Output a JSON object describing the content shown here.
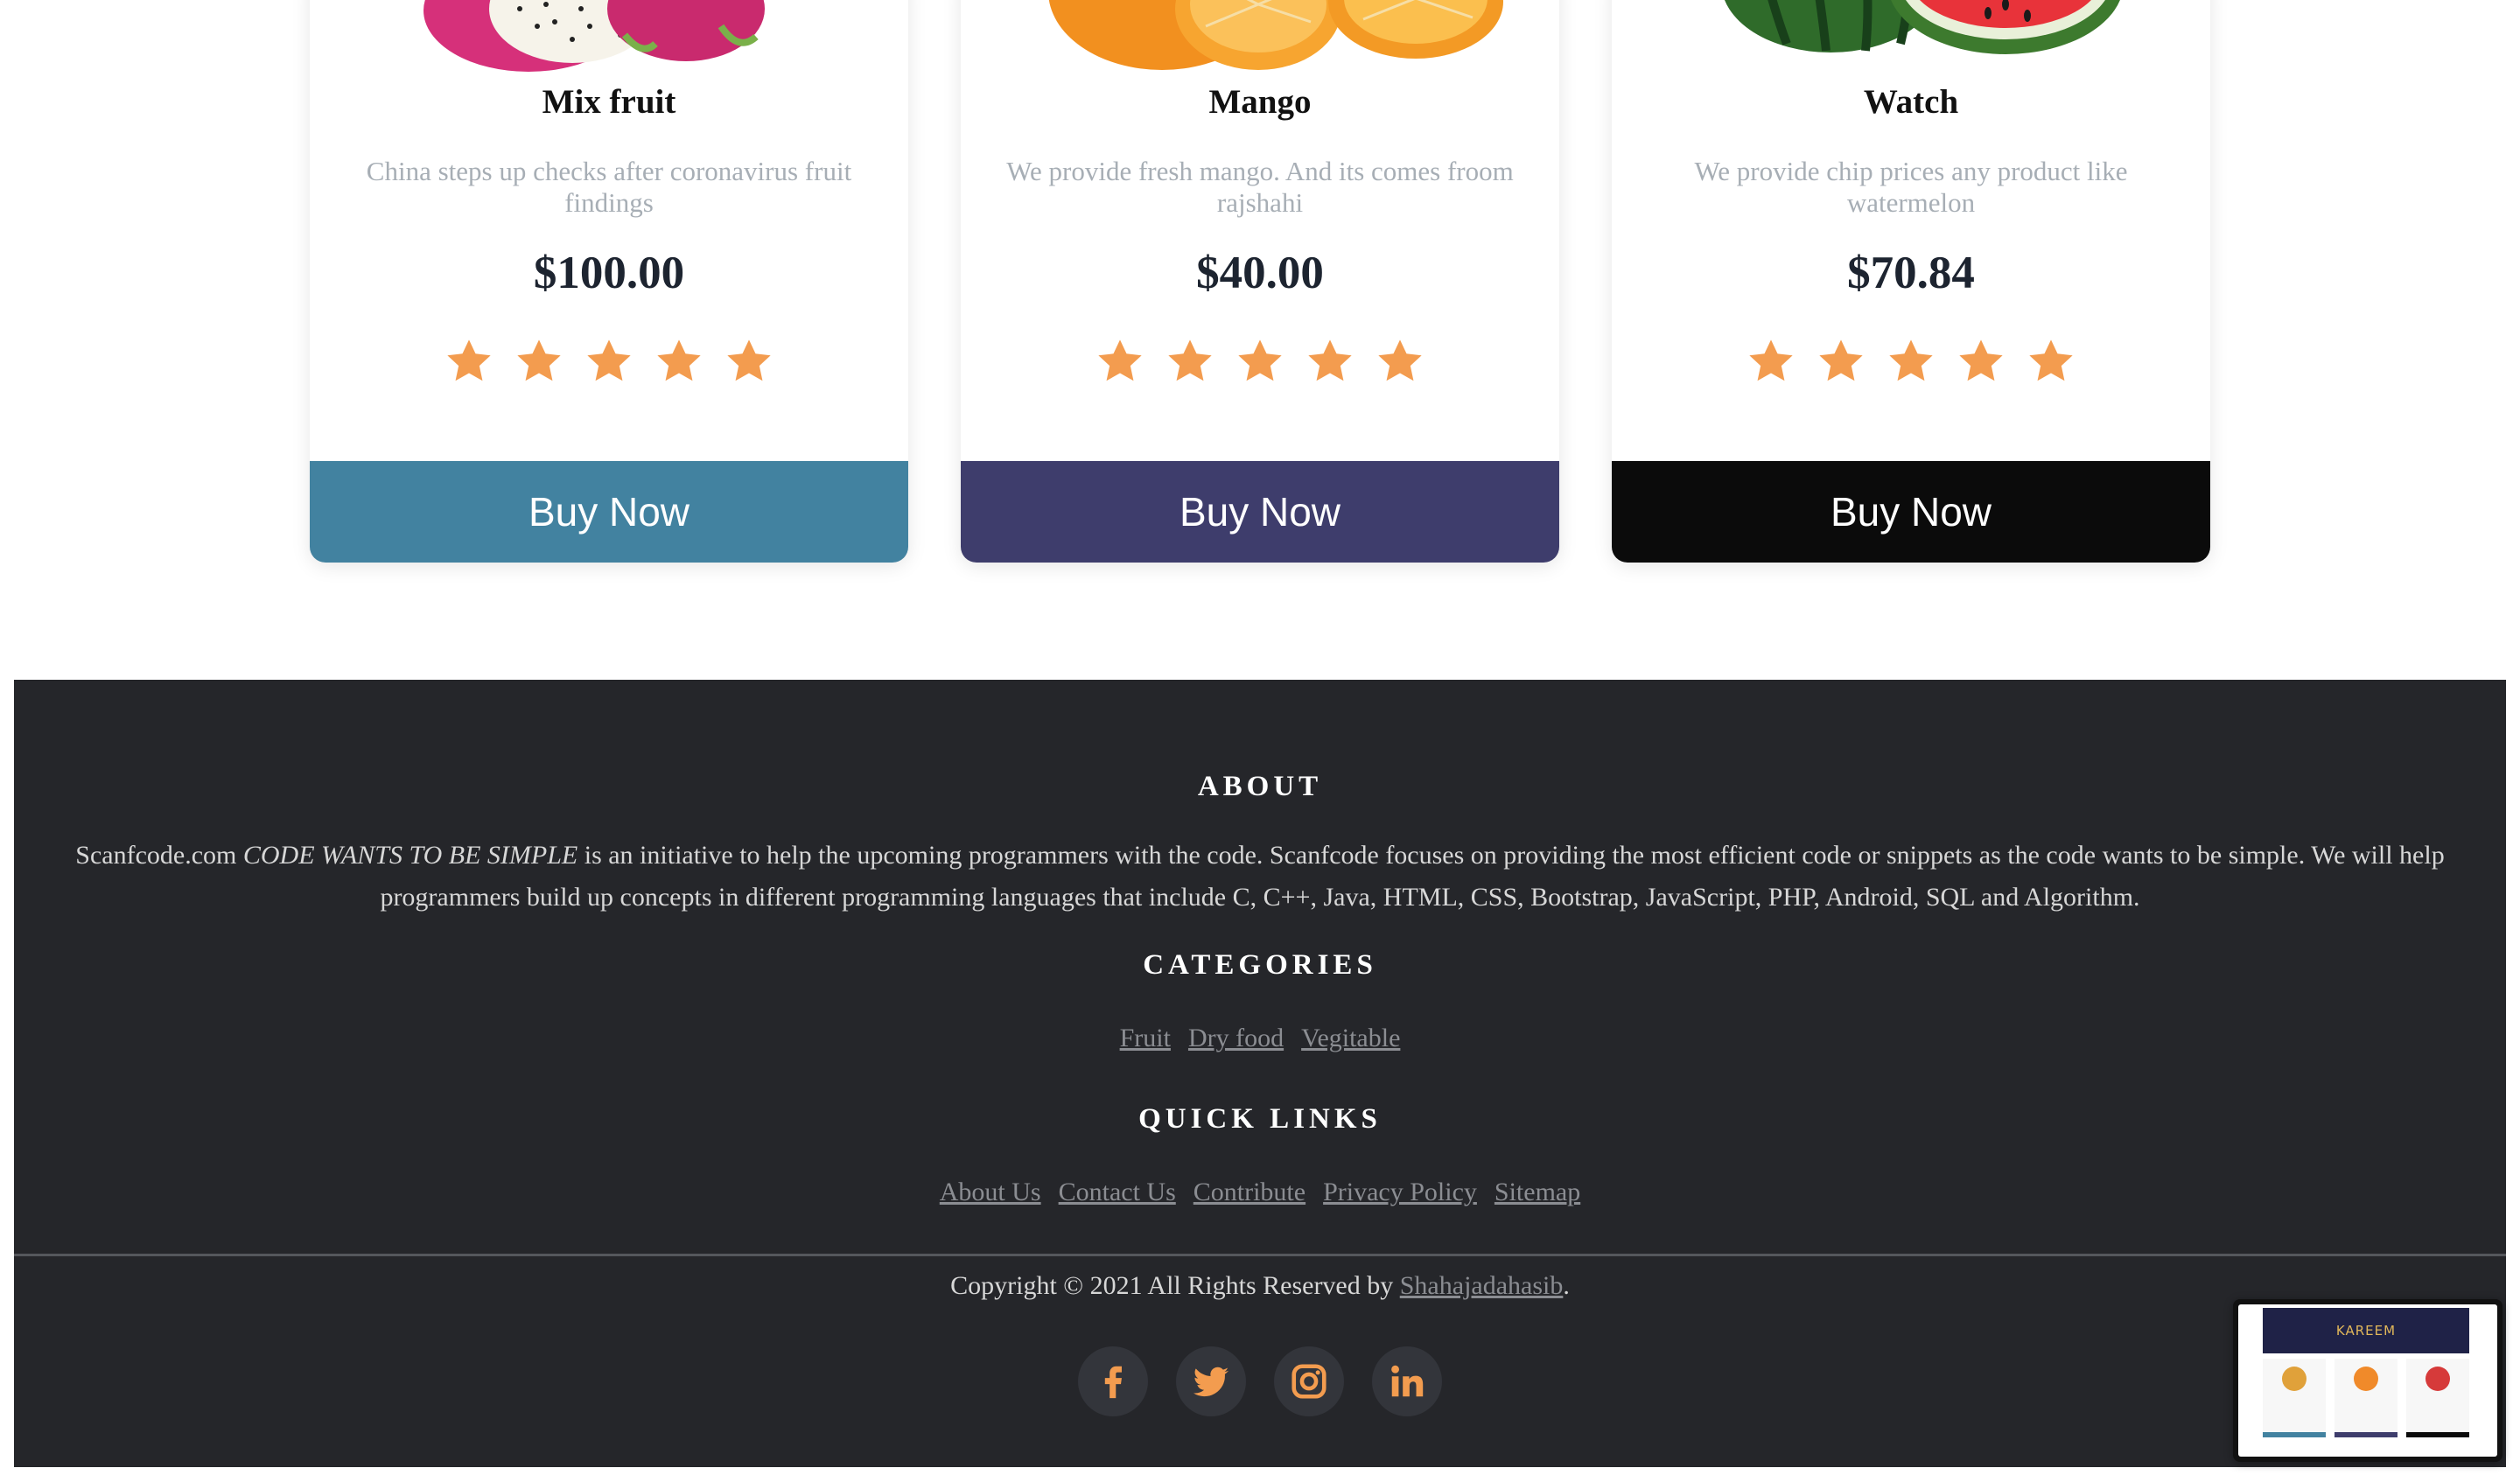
{
  "products": [
    {
      "title": "Mix fruit",
      "description": "China steps up checks after coronavirus fruit findings",
      "price": "$100.00",
      "rating": 5,
      "button_label": "Buy Now",
      "button_color": "#4282a0"
    },
    {
      "title": "Mango",
      "description": "We provide fresh mango. And its comes froom rajshahi",
      "price": "$40.00",
      "rating": 5,
      "button_label": "Buy Now",
      "button_color": "#3e3d6c"
    },
    {
      "title": "Watch",
      "description": "We provide chip prices any product like watermelon",
      "price": "$70.84",
      "rating": 5,
      "button_label": "Buy Now",
      "button_color": "#0b0b0b"
    }
  ],
  "colors": {
    "star": "#f39c4f",
    "footer_bg": "#25262a",
    "link": "#8b8d92"
  },
  "footer": {
    "about_heading": "ABOUT",
    "about_brand": "Scanfcode.com",
    "about_slogan": "CODE WANTS TO BE SIMPLE",
    "about_body": " is an initiative to help the upcoming programmers with the code. Scanfcode focuses on providing the most efficient code or snippets as the code wants to be simple. We will help programmers build up concepts in different programming languages that include C, C++, Java, HTML, CSS, Bootstrap, JavaScript, PHP, Android, SQL and Algorithm.",
    "categories_heading": "CATEGORIES",
    "categories": [
      "Fruit",
      "Dry food",
      "Vegitable"
    ],
    "quick_links_heading": "QUICK LINKS",
    "quick_links": [
      "About Us",
      "Contact Us",
      "Contribute",
      "Privacy Policy",
      "Sitemap"
    ],
    "copyright_prefix": "Copyright © 2021 All Rights Reserved by ",
    "copyright_author": "Shahajadahasib",
    "copyright_suffix": ".",
    "social_icons": [
      "facebook-icon",
      "twitter-icon",
      "instagram-icon",
      "linkedin-icon"
    ]
  },
  "preview_thumbnail": {
    "banner_text": "KAREEM"
  }
}
